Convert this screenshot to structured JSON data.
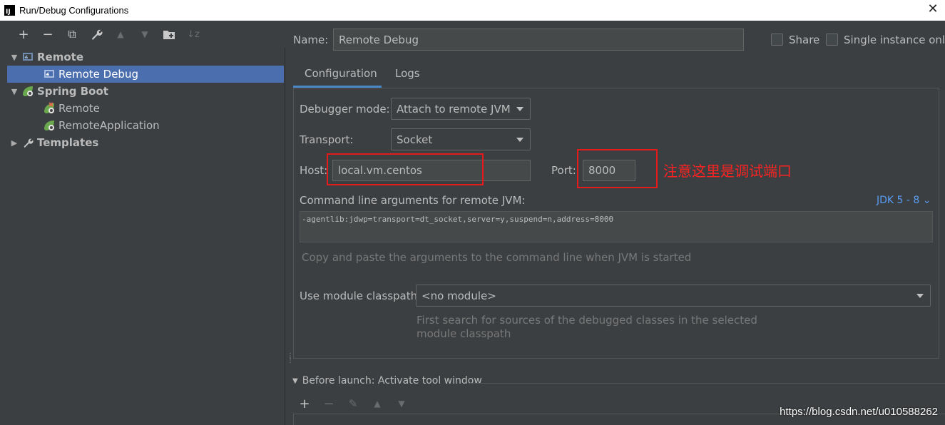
{
  "window": {
    "title": "Run/Debug Configurations",
    "icon_text": "IJ",
    "close_glyph": "✕"
  },
  "toolbar": {
    "buttons": [
      {
        "name": "add-icon",
        "glyph": "+"
      },
      {
        "name": "remove-icon",
        "glyph": "−"
      },
      {
        "name": "copy-icon",
        "glyph": "⧉"
      },
      {
        "name": "wrench-icon",
        "glyph": "🔧"
      },
      {
        "name": "move-up-icon",
        "glyph": "▲"
      },
      {
        "name": "move-down-icon",
        "glyph": "▼"
      },
      {
        "name": "folder-add-icon",
        "glyph": "📁"
      },
      {
        "name": "sort-icon",
        "glyph": "↓z"
      }
    ]
  },
  "tree": {
    "remote_group": "Remote",
    "remote_debug": "Remote Debug",
    "spring_group": "Spring Boot",
    "spring_remote": "Remote",
    "spring_remote_app": "RemoteApplication",
    "templates": "Templates"
  },
  "name_field": {
    "label": "Name:",
    "value": "Remote Debug"
  },
  "share": {
    "label": "Share"
  },
  "single_instance": {
    "label": "Single instance only"
  },
  "tabs": {
    "configuration": "Configuration",
    "logs": "Logs"
  },
  "debugger_mode": {
    "label": "Debugger mode:",
    "value": "Attach to remote JVM"
  },
  "transport": {
    "label": "Transport:",
    "value": "Socket"
  },
  "host": {
    "label": "Host:",
    "value": "local.vm.centos"
  },
  "port": {
    "label": "Port:",
    "value": "8000"
  },
  "annotation": "注意这里是调试端口",
  "command_line": {
    "label": "Command line arguments for remote JVM:",
    "jdk_link": "JDK 5 - 8",
    "value": "-agentlib:jdwp=transport=dt_socket,server=y,suspend=n,address=8000",
    "hint": "Copy and paste the arguments to the command line when JVM is started"
  },
  "module_classpath": {
    "label": "Use module classpath:",
    "value": "<no module>",
    "hint_line1": "First search for sources of the debugged classes in the selected",
    "hint_line2": "module classpath"
  },
  "before_launch": {
    "label": "Before launch: Activate tool window"
  },
  "watermark": "https://blog.csdn.net/u010588262",
  "colors": {
    "accent": "#4b6eaf",
    "link": "#589df6",
    "annotation": "#ff2222"
  }
}
